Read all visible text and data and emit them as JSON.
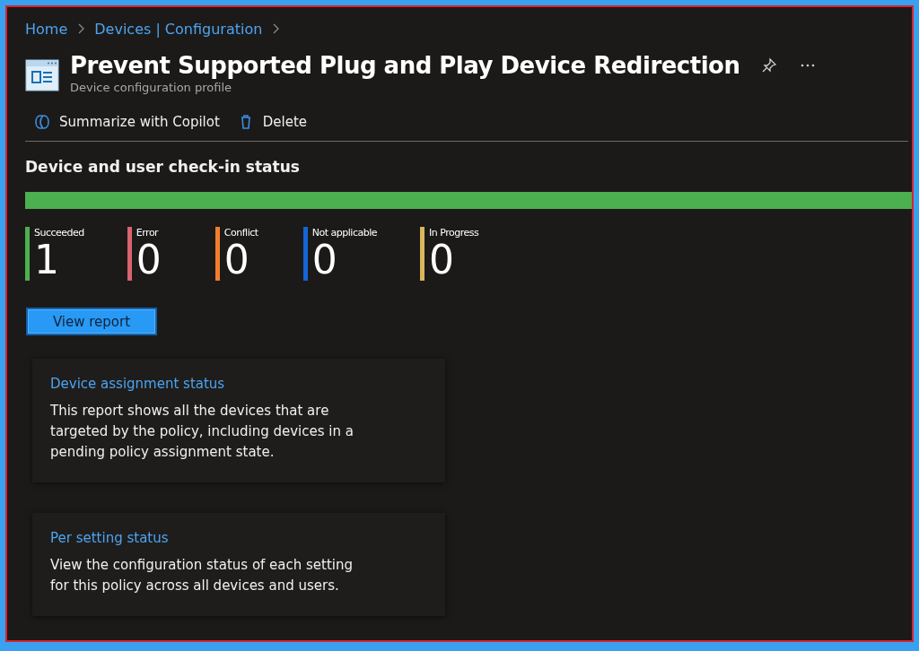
{
  "breadcrumb": [
    "Home",
    "Devices | Configuration"
  ],
  "header": {
    "title": "Prevent Supported Plug and Play Device Redirection",
    "subtitle": "Device configuration profile"
  },
  "toolbar": [
    {
      "kind": "copilot",
      "label": "Summarize with Copilot"
    },
    {
      "kind": "delete",
      "label": "Delete"
    }
  ],
  "status": {
    "title": "Device and user check-in status",
    "bar": {
      "level": 1
    },
    "counts": [
      {
        "label": "Succeeded",
        "value": "1",
        "color": "#4caf50"
      },
      {
        "label": "Error",
        "value": "0",
        "color": "#d9646f"
      },
      {
        "label": "Conflict",
        "value": "0",
        "color": "#f07f2c"
      },
      {
        "label": "Not applicable",
        "value": "0",
        "color": "#1565d8"
      },
      {
        "label": "In Progress",
        "value": "0",
        "color": "#d9b65a"
      }
    ],
    "button": "View report"
  },
  "cards": [
    {
      "title": "Device assignment status",
      "text": "This report shows all the devices that are targeted by the policy, including devices in a pending policy assignment state."
    },
    {
      "title": "Per setting status",
      "text": "View the configuration status of each setting for this policy across all devices and users."
    }
  ]
}
